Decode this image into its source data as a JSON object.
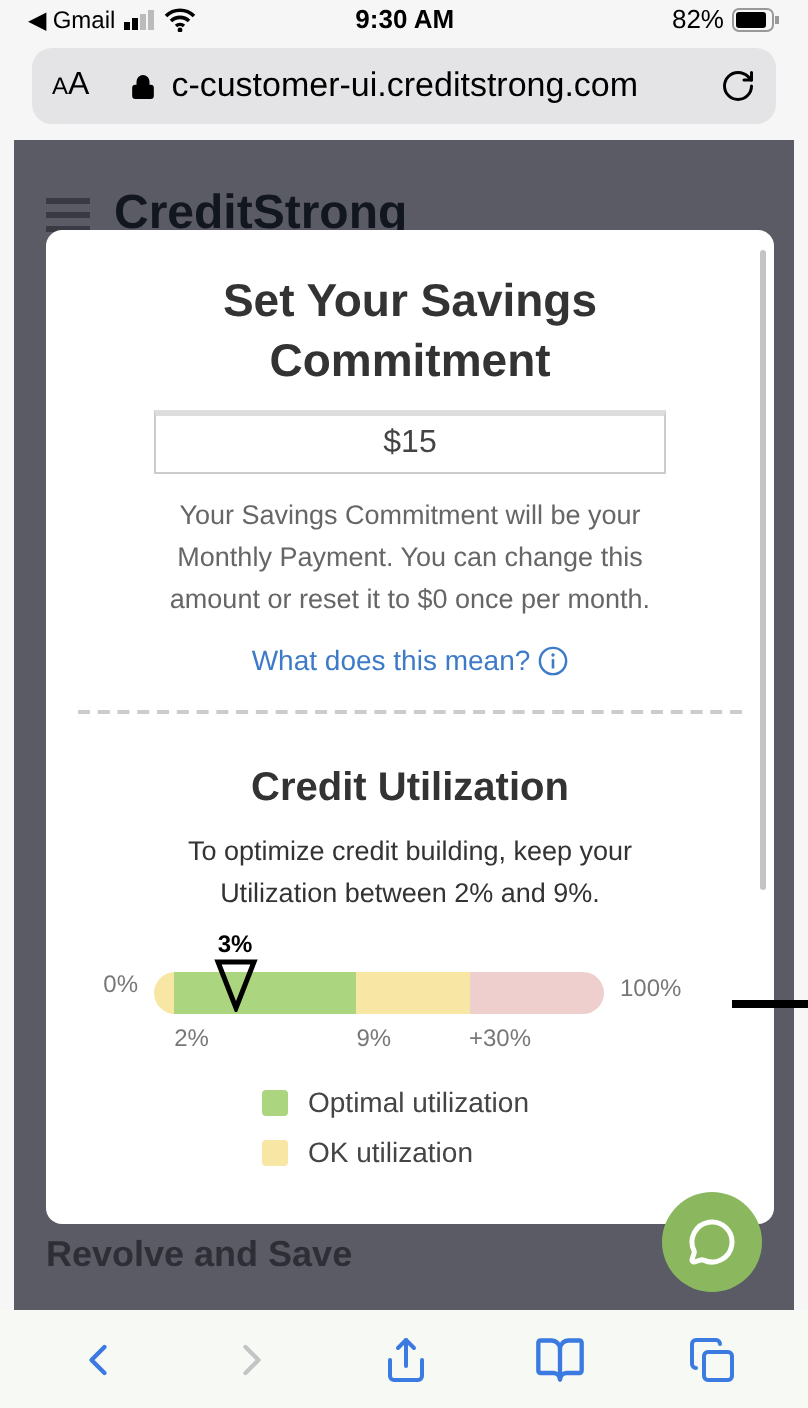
{
  "status_bar": {
    "back_app": "◀ Gmail",
    "time": "9:30 AM",
    "battery": "82%"
  },
  "address_bar": {
    "text_size": "AA",
    "url": "c-customer-ui.creditstrong.com"
  },
  "page": {
    "logo": "CreditStrong",
    "section_title": "Revolve and Save"
  },
  "modal": {
    "title": "Set Your Savings Commitment",
    "amount": "$15",
    "description": "Your Savings Commitment will be your Monthly Payment. You can change this amount or reset it to $0 once per month.",
    "help_link": "What does this mean?",
    "utilization_title": "Credit Utilization",
    "utilization_text": "To optimize credit building, keep your Utilization between 2% and 9%.",
    "meter": {
      "reading": "3%",
      "level": 0.18,
      "min_label": "0%",
      "max_label": "100%",
      "segments": [
        {
          "color": "#f7e6a4"
        },
        {
          "color": "#abd57f"
        },
        {
          "color": "#f7e6a4"
        },
        {
          "color": "#efcfcd"
        }
      ],
      "ticks": [
        "2%",
        "9%",
        "+30%"
      ]
    },
    "legend": [
      {
        "label": "Optimal utilization",
        "color": "#abd57f"
      },
      {
        "label": "OK utilization",
        "color": "#f7e6a4"
      }
    ]
  }
}
